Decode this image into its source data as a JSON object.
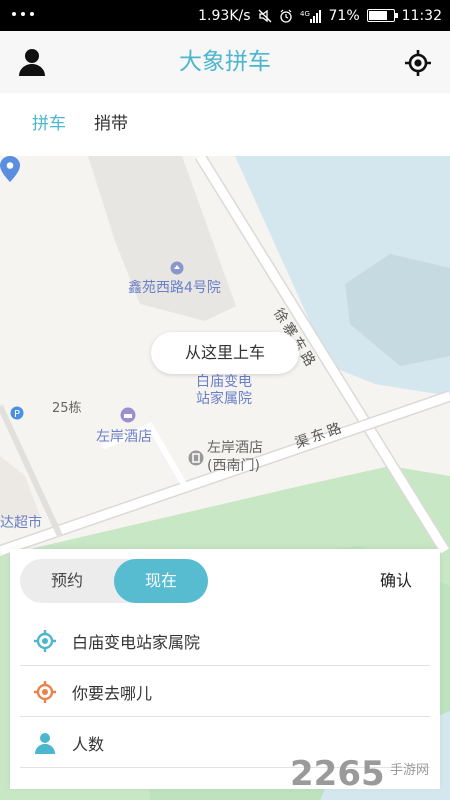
{
  "status_bar": {
    "speed": "1.93K/s",
    "signal_tag": "4G",
    "battery": "71%",
    "battery_level": 0.71,
    "time": "11:32"
  },
  "header": {
    "title": "大象拼车",
    "user_icon": "user-icon",
    "locate_icon": "locate-icon"
  },
  "tabs": [
    {
      "label": "拼车",
      "active": true
    },
    {
      "label": "捎带",
      "active": false
    }
  ],
  "map": {
    "pickup_hint": "从这里上车",
    "labels": {
      "poi_xinyuan": "鑫苑西路4号院",
      "poi_station": "白庙变电站家属院",
      "poi_zuoan": "左岸酒店",
      "poi_zuoan_west": "左岸酒店(西南门)",
      "bldg_25": "25栋",
      "road_xuzhai": "徐寨东路",
      "road_qu": "渠东路",
      "market": "达超市"
    },
    "colors": {
      "water": "#d4e6ee",
      "green": "#c7e7c5",
      "accent": "#4bb6cd"
    }
  },
  "panel": {
    "mode_book": "预约",
    "mode_now": "现在",
    "active_mode": "now",
    "confirm": "确认",
    "start": "白庙变电站家属院",
    "destination_placeholder": "你要去哪儿",
    "people_placeholder": "人数"
  },
  "watermark": {
    "brand": "2265",
    "site": "手游网"
  }
}
